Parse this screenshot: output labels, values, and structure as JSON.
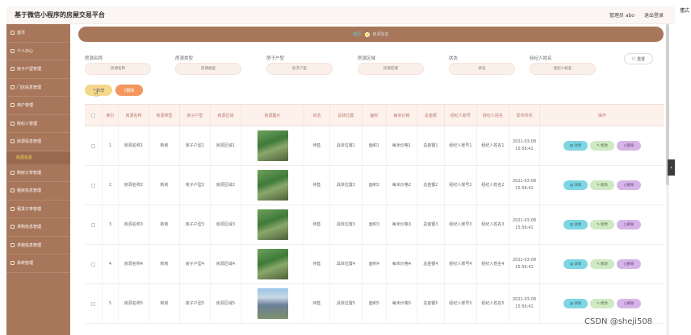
{
  "app": {
    "title": "基于微信小程序的房屋交易平台",
    "user_label": "管理员 abo",
    "logout_label": "退出登录",
    "corner_text": "懂式"
  },
  "sidebar": {
    "items": [
      {
        "label": "首页",
        "icon": "home-icon"
      },
      {
        "label": "个人中心",
        "icon": "user-icon"
      },
      {
        "label": "房子户型管理",
        "icon": "menu-icon"
      },
      {
        "label": "门店信息管理",
        "icon": "menu-icon"
      },
      {
        "label": "用户管理",
        "icon": "menu-icon"
      },
      {
        "label": "经纪人管理",
        "icon": "menu-icon"
      },
      {
        "label": "房源信息管理",
        "icon": "menu-icon"
      }
    ],
    "active_sub": "房源信息",
    "items_after": [
      {
        "label": "购房订单管理",
        "icon": "menu-icon"
      },
      {
        "label": "租房信息管理",
        "icon": "menu-icon"
      },
      {
        "label": "租赁订单管理",
        "icon": "menu-icon"
      },
      {
        "label": "求购信息管理",
        "icon": "menu-icon"
      },
      {
        "label": "求租信息管理",
        "icon": "menu-icon"
      },
      {
        "label": "系统管理",
        "icon": "menu-icon"
      }
    ]
  },
  "breadcrumb": {
    "home": "首页",
    "current": "房源信息"
  },
  "filters": [
    {
      "label": "房源名称",
      "placeholder": "房源名称"
    },
    {
      "label": "房源类型",
      "placeholder": "房源类型"
    },
    {
      "label": "房子户型",
      "placeholder": "房子户型"
    },
    {
      "label": "房源区域",
      "placeholder": "房源区域"
    },
    {
      "label": "状态",
      "placeholder": "状态"
    },
    {
      "label": "经纪人姓名",
      "placeholder": "经纪人姓名"
    }
  ],
  "buttons": {
    "reset": "重置",
    "add": "新增",
    "delete": "删除",
    "detail": "详情",
    "edit": "修改",
    "row_delete": "删除"
  },
  "table": {
    "headers": [
      "",
      "索引",
      "房源名称",
      "房源类型",
      "房子户型",
      "房源区域",
      "房源图片",
      "状态",
      "具体位置",
      "面积",
      "每米价格",
      "总金额",
      "经纪人账号",
      "经纪人姓名",
      "发布时间",
      "操作"
    ],
    "rows": [
      {
        "index": "1",
        "name": "房源名称1",
        "type": "新房",
        "layout": "房子户型1",
        "area_zone": "房源区域1",
        "photo": "green",
        "status": "待售",
        "location": "具体位置1",
        "area": "面积1",
        "price": "每米价格1",
        "total": "总金额1",
        "agent_acct": "经纪人账号1",
        "agent_name": "经纪人姓名1",
        "time": "2021-03-08\n15:56:41"
      },
      {
        "index": "2",
        "name": "房源名称2",
        "type": "新房",
        "layout": "房子户型2",
        "area_zone": "房源区域2",
        "photo": "green",
        "status": "待售",
        "location": "具体位置2",
        "area": "面积2",
        "price": "每米价格2",
        "total": "总金额2",
        "agent_acct": "经纪人账号2",
        "agent_name": "经纪人姓名2",
        "time": "2021-03-08\n15:56:41"
      },
      {
        "index": "3",
        "name": "房源名称3",
        "type": "新房",
        "layout": "房子户型3",
        "area_zone": "房源区域3",
        "photo": "green",
        "status": "待售",
        "location": "具体位置3",
        "area": "面积3",
        "price": "每米价格3",
        "total": "总金额3",
        "agent_acct": "经纪人账号3",
        "agent_name": "经纪人姓名3",
        "time": "2021-03-08\n15:56:41"
      },
      {
        "index": "4",
        "name": "房源名称4",
        "type": "新房",
        "layout": "房子户型4",
        "area_zone": "房源区域4",
        "photo": "green",
        "status": "待售",
        "location": "具体位置4",
        "area": "面积4",
        "price": "每米价格4",
        "total": "总金额4",
        "agent_acct": "经纪人账号4",
        "agent_name": "经纪人姓名4",
        "time": "2021-03-08\n15:56:41"
      },
      {
        "index": "5",
        "name": "房源名称5",
        "type": "新房",
        "layout": "房子户型5",
        "area_zone": "房源区域5",
        "photo": "blue",
        "status": "待售",
        "location": "具体位置5",
        "area": "面积5",
        "price": "每米价格5",
        "total": "总金额5",
        "agent_acct": "经纪人账号5",
        "agent_name": "经纪人姓名5",
        "time": "2021-03-08\n15:56:41"
      }
    ]
  },
  "watermark": "CSDN @sheji508",
  "colors": {
    "sidebar": "#a8765a",
    "accent_yellow": "#f6d84b",
    "delete_orange": "#f3975f",
    "detail_cyan": "#7fd6e3",
    "edit_green": "#cfe9c3",
    "del_purple": "#d5b5e6"
  }
}
